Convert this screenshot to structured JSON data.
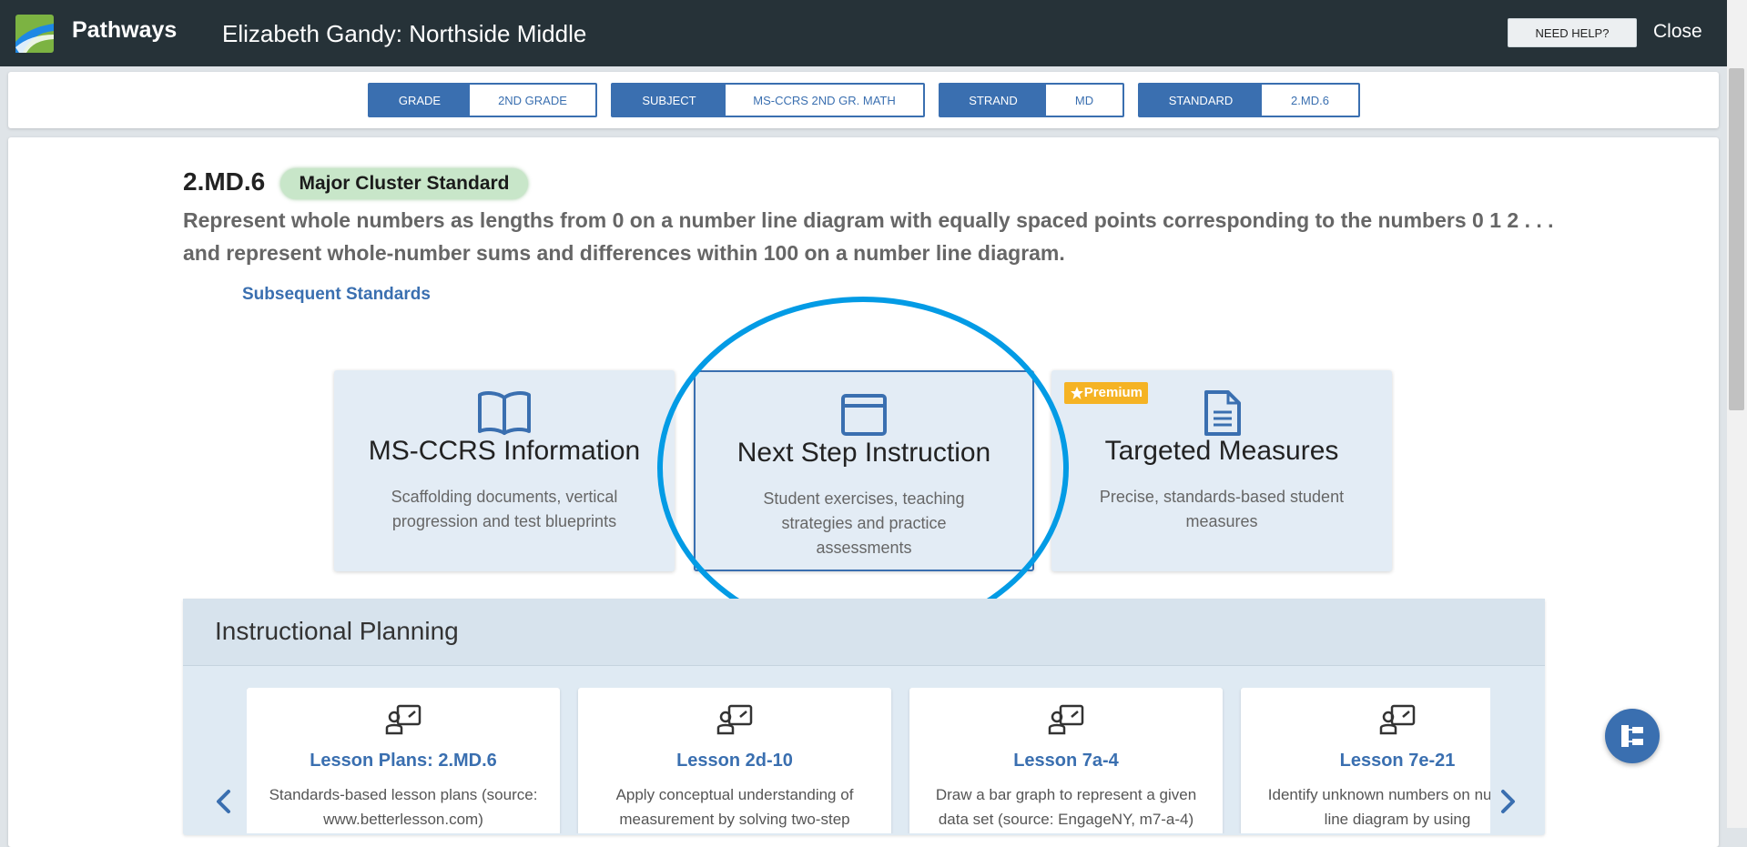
{
  "header": {
    "brand": "Pathways",
    "page_title": "Elizabeth Gandy: Northside Middle",
    "help_label": "NEED HELP?",
    "close_label": "Close"
  },
  "filters": [
    {
      "key": "GRADE",
      "value": "2ND GRADE"
    },
    {
      "key": "SUBJECT",
      "value": "MS-CCRS 2ND GR. MATH"
    },
    {
      "key": "STRAND",
      "value": "MD"
    },
    {
      "key": "STANDARD",
      "value": "2.MD.6"
    }
  ],
  "standard": {
    "code": "2.MD.6",
    "badge": "Major Cluster Standard",
    "description": "Represent whole numbers as lengths from 0 on a number line diagram with equally spaced points corresponding to the numbers 0 1 2 . . . and represent whole-number sums and differences within 100 on a number line diagram.",
    "subsequent_link": "Subsequent Standards"
  },
  "tiles": [
    {
      "title": "MS-CCRS Information",
      "desc": "Scaffolding documents, vertical progression and test blueprints",
      "icon": "book-icon"
    },
    {
      "title": "Next Step Instruction",
      "desc": "Student exercises, teaching strategies and practice assessments",
      "icon": "browser-window-icon"
    },
    {
      "title": "Targeted Measures",
      "desc": "Precise, standards-based student measures",
      "icon": "document-icon",
      "badge": "Premium"
    }
  ],
  "planning": {
    "title": "Instructional Planning",
    "lessons": [
      {
        "title": "Lesson Plans: 2.MD.6",
        "desc": "Standards-based lesson plans (source: www.betterlesson.com)"
      },
      {
        "title": "Lesson 2d-10",
        "desc": "Apply conceptual understanding of measurement by solving two-step"
      },
      {
        "title": "Lesson 7a-4",
        "desc": "Draw a bar graph to represent a given data set (source: EngageNY, m7-a-4)"
      },
      {
        "title": "Lesson 7e-21",
        "desc": "Identify unknown numbers on number line diagram by using"
      }
    ]
  },
  "colors": {
    "header_bg": "#263238",
    "accent": "#3a6fb0",
    "highlight_circle": "#039be5",
    "premium": "#f5b324",
    "badge_green": "#c8e6c9"
  }
}
